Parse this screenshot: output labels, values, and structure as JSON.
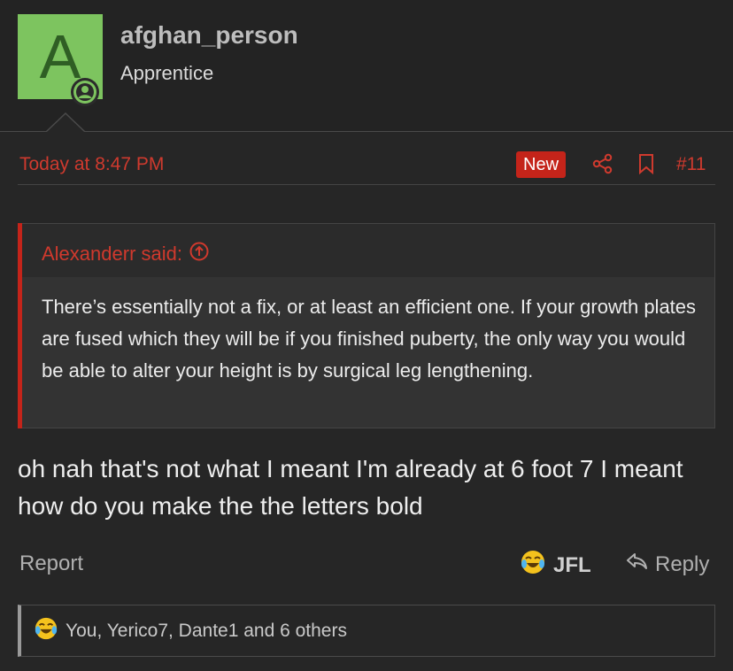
{
  "user": {
    "avatar_letter": "A",
    "name": "afghan_person",
    "title": "Apprentice"
  },
  "post": {
    "date": "Today at 8:47 PM",
    "new_badge": "New",
    "number": "#11",
    "body": "oh nah that's not what I meant I'm already at 6 foot 7 I meant how do you make the the letters bold"
  },
  "quote": {
    "author": "Alexanderr said:",
    "text": "There’s essentially not a fix, or at least an efficient one. If your growth plates are fused which they will be if you finished puberty, the only way you would be able to alter your height is by surgical leg lengthening."
  },
  "actions": {
    "report": "Report",
    "reaction_label": "JFL",
    "reply": "Reply"
  },
  "reactions_summary": "You, Yerico7, Dante1 and 6 others",
  "colors": {
    "accent_red": "#c4241a",
    "avatar_green": "#7dc45f",
    "background": "#232323"
  },
  "icons": [
    "online-status-icon",
    "share-icon",
    "bookmark-icon",
    "arrow-up-circle-icon",
    "laughing-crying-emoji-icon",
    "reply-arrow-icon"
  ]
}
